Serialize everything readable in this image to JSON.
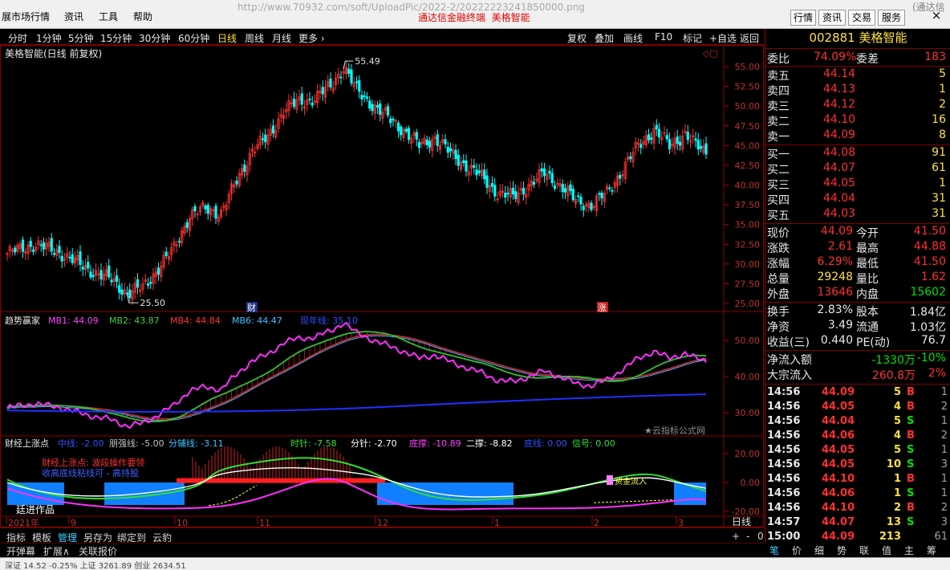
{
  "titlebar": {
    "menus": [
      "展市场行情",
      "资讯",
      "工具",
      "帮助"
    ],
    "url_text": "http://www.70932.com/soft/UploadPic/2022-2/20222223241850000.png",
    "brand": "通达信金融终端",
    "stock_title": "美格智能",
    "buttons": [
      "行情",
      "资讯",
      "交易",
      "服务"
    ],
    "right_glyph": "(通达信",
    "close": "×"
  },
  "periodbar": {
    "items": [
      "分时",
      "1分钟",
      "5分钟",
      "15分钟",
      "30分钟",
      "60分钟",
      "日线",
      "周线",
      "月线",
      "更多 ›"
    ],
    "active": "日线",
    "right_items": [
      "复权",
      "叠加",
      "画线",
      "F10",
      "标记",
      "+自选",
      "返回"
    ]
  },
  "main": {
    "label": "美格智能(日线 前复权)",
    "high_label": "55.49",
    "low_label": "25.50",
    "badge_cai": "财",
    "badge_zhang": "涨",
    "y_ticks": [
      "55.00",
      "52.50",
      "50.00",
      "47.50",
      "45.00",
      "42.50",
      "40.00",
      "37.50",
      "35.00",
      "32.50",
      "30.00",
      "27.50",
      "25.00"
    ]
  },
  "ind1": {
    "name": "趋势赢家",
    "mb1": "MB1: 44.09",
    "mb2": "MB2: 43.87",
    "mb4": "MB4: 44.84",
    "mb6": "MB6: 44.47",
    "year": "现年线: 35.10",
    "y_ticks": [
      "50.00",
      "40.00",
      "30.00"
    ],
    "watermark": "★云指标公式网"
  },
  "ind2": {
    "name": "财经上涨点",
    "zhong": "中线: -2.00",
    "qiang": "朋强线: -5.00",
    "fenfu": "分辅线: -3.11",
    "shi": "时针: -7.58",
    "fen": "分针: -2.70",
    "dicheng": "底撑: -10.89",
    "ercheng": "二撑: -8.82",
    "dixian": "底线: 0.00",
    "xinhao": "信号: 0.00",
    "note_red": "财经上涨点: 波段操作要领",
    "note_blue": "收高底线粘线可 - 高持股",
    "note_yellow": "资金流入",
    "author": "廷进作品",
    "y_ticks": [
      "20.00",
      "0.00",
      "-20.00"
    ]
  },
  "xaxis": {
    "labels": [
      "2021年",
      "9",
      "10",
      "11",
      "12",
      "1",
      "2",
      "3"
    ],
    "period": "日线"
  },
  "bottombar": {
    "items": [
      "指标",
      "模板",
      "管理",
      "另存为",
      "绑定到",
      "云豹"
    ],
    "items2": [
      "开弹幕",
      "扩展∧",
      "关联报价"
    ],
    "right_controls": [
      "+",
      "-",
      "0"
    ]
  },
  "quote": {
    "code": "002881",
    "name": "美格智能",
    "weibi_label": "委比",
    "weibi": "74.09%",
    "weicha_label": "委差",
    "weicha": "183",
    "sells": [
      {
        "label": "卖五",
        "price": "44.14",
        "vol": "5"
      },
      {
        "label": "卖四",
        "price": "44.13",
        "vol": "1"
      },
      {
        "label": "卖三",
        "price": "44.12",
        "vol": "2"
      },
      {
        "label": "卖二",
        "price": "44.10",
        "vol": "16"
      },
      {
        "label": "卖一",
        "price": "44.09",
        "vol": "8"
      }
    ],
    "buys": [
      {
        "label": "买一",
        "price": "44.08",
        "vol": "91"
      },
      {
        "label": "买二",
        "price": "44.07",
        "vol": "61"
      },
      {
        "label": "买三",
        "price": "44.05",
        "vol": "1"
      },
      {
        "label": "买四",
        "price": "44.04",
        "vol": "31"
      },
      {
        "label": "买五",
        "price": "44.03",
        "vol": "31"
      }
    ],
    "stats": [
      {
        "l1": "现价",
        "v1": "44.09",
        "l2": "今开",
        "v2": "41.50"
      },
      {
        "l1": "涨跌",
        "v1": "2.61",
        "l2": "最高",
        "v2": "44.88"
      },
      {
        "l1": "涨幅",
        "v1": "6.29%",
        "l2": "最低",
        "v2": "41.50"
      },
      {
        "l1": "总量",
        "v1": "29248",
        "l2": "量比",
        "v2": "1.62"
      },
      {
        "l1": "外盘",
        "v1": "13646",
        "l2": "内盘",
        "v2": "15602"
      }
    ],
    "stats2": [
      {
        "l1": "换手",
        "v1": "2.83%",
        "l2": "股本",
        "v2": "1.84亿"
      },
      {
        "l1": "净资",
        "v1": "3.49",
        "l2": "流通",
        "v2": "1.03亿"
      },
      {
        "l1": "收益(三)",
        "v1": "0.440",
        "l2": "PE(动)",
        "v2": "76.7"
      }
    ],
    "flow": [
      {
        "label": "净流入额",
        "v1": "-1330万",
        "v2": "-10%"
      },
      {
        "label": "大宗流入",
        "v1": "260.8万",
        "v2": "2%"
      }
    ]
  },
  "ticks": [
    {
      "t": "14:56",
      "p": "44.09",
      "v": "5",
      "bs": "B",
      "n": "1"
    },
    {
      "t": "14:56",
      "p": "44.05",
      "v": "4",
      "bs": "B",
      "n": "2"
    },
    {
      "t": "14:56",
      "p": "44.04",
      "v": "5",
      "bs": "S",
      "n": "1"
    },
    {
      "t": "14:56",
      "p": "44.06",
      "v": "4",
      "bs": "B",
      "n": "2"
    },
    {
      "t": "14:56",
      "p": "44.05",
      "v": "5",
      "bs": "S",
      "n": "1"
    },
    {
      "t": "14:56",
      "p": "44.05",
      "v": "10",
      "bs": "S",
      "n": "3"
    },
    {
      "t": "14:56",
      "p": "44.10",
      "v": "1",
      "bs": "B",
      "n": "1"
    },
    {
      "t": "14:56",
      "p": "44.06",
      "v": "1",
      "bs": "S",
      "n": "1"
    },
    {
      "t": "14:56",
      "p": "44.10",
      "v": "2",
      "bs": "B",
      "n": "2"
    },
    {
      "t": "14:57",
      "p": "44.07",
      "v": "13",
      "bs": "S",
      "n": "3"
    },
    {
      "t": "15:00",
      "p": "44.09",
      "v": "213",
      "bs": "",
      "n": "61"
    }
  ],
  "right_tabs": [
    "笔",
    "价",
    "细",
    "势",
    "联",
    "值",
    "主",
    "筹"
  ],
  "status": {
    "text": "深证 14.52 -0.25%  上证 3261.89  创业 2634.51"
  },
  "colors": {
    "up": "#ff3030",
    "down": "#00ffff",
    "accent": "#ffe040",
    "text_green": "#00e000"
  }
}
